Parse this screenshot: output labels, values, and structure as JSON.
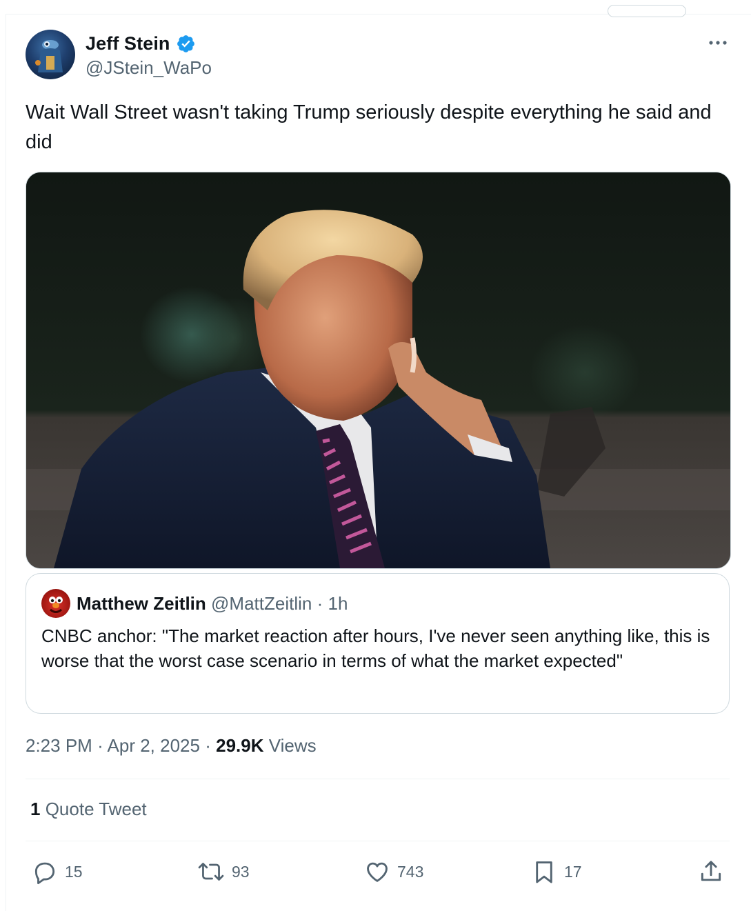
{
  "author": {
    "name": "Jeff Stein",
    "handle": "@JStein_WaPo",
    "verified": true
  },
  "tweet": {
    "text": "Wait Wall Street wasn't taking Trump seriously despite everything he said and did"
  },
  "quoted_tweet": {
    "name": "Matthew Zeitlin",
    "handle": "@MattZeitlin",
    "separator": "·",
    "time": "1h",
    "text": "CNBC anchor: \"The market reaction after hours, I've never seen anything like, this is worse that the worst case scenario in terms of what the market expected\""
  },
  "meta": {
    "time": "2:23 PM",
    "sep1": "·",
    "date": "Apr 2, 2025",
    "sep2": "·",
    "views_count": "29.9K",
    "views_label": "Views"
  },
  "quotes": {
    "count": "1",
    "label": "Quote Tweet"
  },
  "actions": {
    "replies": "15",
    "retweets": "93",
    "likes": "743",
    "bookmarks": "17"
  },
  "colors": {
    "secondary_text": "#536471",
    "primary_text": "#0f1419",
    "verified_blue": "#1d9bf0",
    "border": "#cfd9de",
    "divider": "#eff3f4"
  },
  "icons": {
    "more": "more-icon",
    "verified": "verified-badge-icon",
    "reply": "reply-icon",
    "retweet": "retweet-icon",
    "like": "heart-icon",
    "bookmark": "bookmark-icon",
    "share": "share-icon"
  }
}
